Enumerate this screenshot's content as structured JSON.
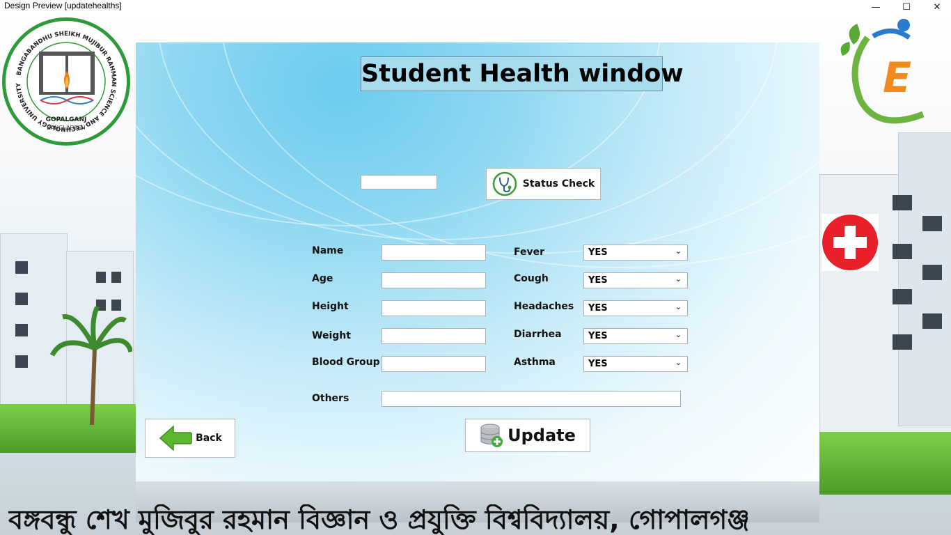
{
  "window": {
    "title": "Design Preview [updatehealths]",
    "controls": {
      "minimize": "—",
      "maximize": "☐",
      "close": "✕"
    }
  },
  "logos": {
    "university_ring_text": "BANGABANDHU SHEIKH MUJIBUR RAHMAN SCIENCE AND TECHNOLOGY UNIVERSITY",
    "university_city": "GOPALGANJ",
    "university_country": "BANGLADESH",
    "app_logo_letter": "E"
  },
  "header": {
    "title": "Student Health window"
  },
  "search": {
    "id_value": "",
    "status_check_label": "Status Check"
  },
  "form": {
    "left_fields": [
      {
        "label": "Name",
        "value": ""
      },
      {
        "label": "Age",
        "value": ""
      },
      {
        "label": "Height",
        "value": ""
      },
      {
        "label": "Weight",
        "value": ""
      },
      {
        "label": "Blood Group",
        "value": ""
      }
    ],
    "right_fields": [
      {
        "label": "Fever",
        "value": "YES"
      },
      {
        "label": "Cough",
        "value": "YES"
      },
      {
        "label": "Headaches",
        "value": "YES"
      },
      {
        "label": "Diarrhea",
        "value": "YES"
      },
      {
        "label": "Asthma",
        "value": "YES"
      }
    ],
    "others": {
      "label": "Others",
      "value": ""
    }
  },
  "actions": {
    "back_label": "Back",
    "update_label": "Update"
  },
  "footer": {
    "banner_text": "বঙ্গবন্ধু শেখ মুজিবুর রহমান বিজ্ঞান ও প্রযুক্তি বিশ্ববিদ্যালয়, গোপালগঞ্জ"
  },
  "colors": {
    "panel_sky": "#8fd8f2",
    "logo_green": "#2e9a3a",
    "cross_red": "#e8202a",
    "app_orange": "#f08a1c"
  }
}
